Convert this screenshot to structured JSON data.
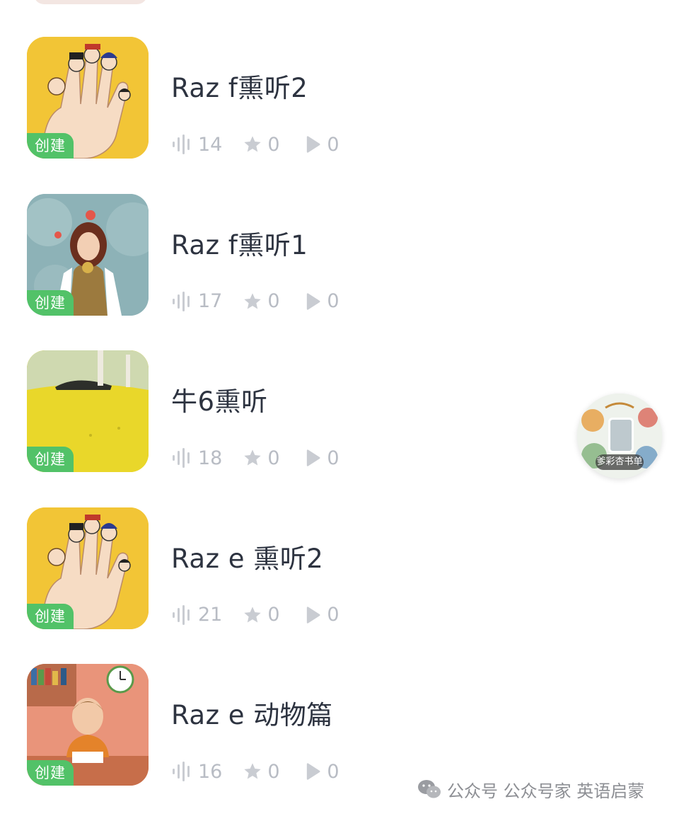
{
  "badge_label": "创建",
  "colors": {
    "accent_green": "#52c268",
    "title_text": "#2d3340",
    "stat_gray": "#b8bcc4"
  },
  "icons": {
    "plays": "soundwave-icon",
    "favorites": "star-icon",
    "shares": "play-icon"
  },
  "playlists": [
    {
      "title": "Raz f熏听2",
      "track_count": "14",
      "stars": "0",
      "plays": "0",
      "cover": "finger-family-yellow"
    },
    {
      "title": "Raz f熏听1",
      "track_count": "17",
      "stars": "0",
      "plays": "0",
      "cover": "girl-in-forest-blue"
    },
    {
      "title": "牛6熏听",
      "track_count": "18",
      "stars": "0",
      "plays": "0",
      "cover": "yellow-field"
    },
    {
      "title": "Raz e 熏听2",
      "track_count": "21",
      "stars": "0",
      "plays": "0",
      "cover": "finger-family-yellow"
    },
    {
      "title": "Raz e 动物篇",
      "track_count": "16",
      "stars": "0",
      "plays": "0",
      "cover": "boy-at-desk"
    }
  ],
  "floating_button": {
    "label": "爹彩杏书单",
    "icon": "phone-icon"
  },
  "watermark": {
    "text": "公众号 公众号家 英语启蒙",
    "icon": "wechat-icon"
  }
}
